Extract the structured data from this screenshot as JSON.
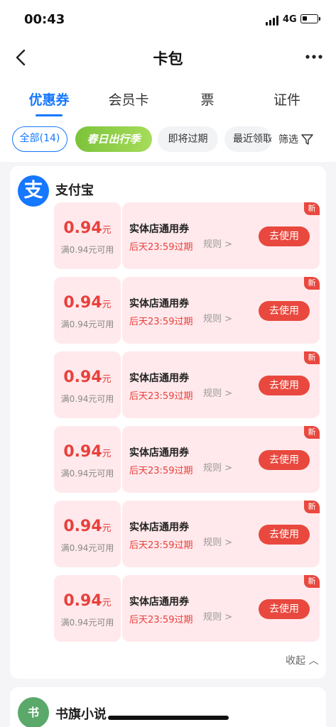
{
  "status_bar": {
    "time": "00:43",
    "network": "4G"
  },
  "nav": {
    "title": "卡包"
  },
  "tabs": [
    {
      "label": "优惠券",
      "active": true
    },
    {
      "label": "会员卡"
    },
    {
      "label": "票"
    },
    {
      "label": "证件"
    }
  ],
  "filters": {
    "chips": [
      "全部(14)",
      "春日出行季",
      "即将过期",
      "最近领取"
    ],
    "filter_label": "筛选"
  },
  "group": {
    "brand": "支付宝",
    "logo_char": "支",
    "coupons": [
      {
        "amount": "0.94",
        "unit": "元",
        "condition": "满0.94元可用",
        "title": "实体店通用券",
        "expire": "后天23:59过期",
        "rules": "规则 >",
        "button": "去使用",
        "badge": "新"
      },
      {
        "amount": "0.94",
        "unit": "元",
        "condition": "满0.94元可用",
        "title": "实体店通用券",
        "expire": "后天23:59过期",
        "rules": "规则 >",
        "button": "去使用",
        "badge": "新"
      },
      {
        "amount": "0.94",
        "unit": "元",
        "condition": "满0.94元可用",
        "title": "实体店通用券",
        "expire": "后天23:59过期",
        "rules": "规则 >",
        "button": "去使用",
        "badge": "新"
      },
      {
        "amount": "0.94",
        "unit": "元",
        "condition": "满0.94元可用",
        "title": "实体店通用券",
        "expire": "后天23:59过期",
        "rules": "规则 >",
        "button": "去使用",
        "badge": "新"
      },
      {
        "amount": "0.94",
        "unit": "元",
        "condition": "满0.94元可用",
        "title": "实体店通用券",
        "expire": "后天23:59过期",
        "rules": "规则 >",
        "button": "去使用",
        "badge": "新"
      },
      {
        "amount": "0.94",
        "unit": "元",
        "condition": "满0.94元可用",
        "title": "实体店通用券",
        "expire": "后天23:59过期",
        "rules": "规则 >",
        "button": "去使用",
        "badge": "新"
      }
    ],
    "collapse_label": "收起 ︿"
  },
  "group2": {
    "brand": "书旗小说",
    "logo_char": "书"
  },
  "colors": {
    "accent": "#1677ff",
    "coupon_red": "#e9483e",
    "coupon_bg": "#ffe9ec"
  },
  "icons": [
    "back-icon",
    "more-icon",
    "filter-icon",
    "signal-icon",
    "battery-icon"
  ]
}
